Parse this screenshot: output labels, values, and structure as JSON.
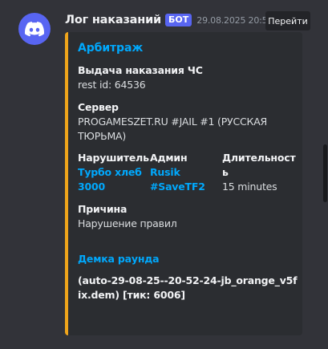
{
  "message": {
    "author": "Лог наказаний",
    "bot_badge": "БОТ",
    "timestamp": "29.08.2025 20:53",
    "jump_button": "Перейти",
    "avatar_icon": "discord-logo-icon",
    "colors": {
      "accent": "#f0a51b",
      "brand": "#5865f2",
      "link": "#00a8fc"
    }
  },
  "embed": {
    "title": "Арбитраж",
    "fields": {
      "ban_issue": {
        "name": "Выдача наказания ЧС",
        "value": "rest id: 64536"
      },
      "server": {
        "name": "Сервер",
        "value": "PROGAMESZET.RU #JAIL #1 (РУССКАЯ ТЮРЬМА)"
      },
      "violator": {
        "name": "Нарушитель",
        "value": "Турбо хлеб 3000"
      },
      "admin": {
        "name": "Админ",
        "value": "Rusik #SaveTF2"
      },
      "duration": {
        "name": "Длительность",
        "value": "15 minutes"
      },
      "reason": {
        "name": "Причина",
        "value": "Нарушение правил"
      }
    },
    "demo": {
      "title": "Демка раунда",
      "value": "(auto-29-08-25--20-52-24-jb_orange_v5fix.dem) [тик: 6006]"
    }
  }
}
